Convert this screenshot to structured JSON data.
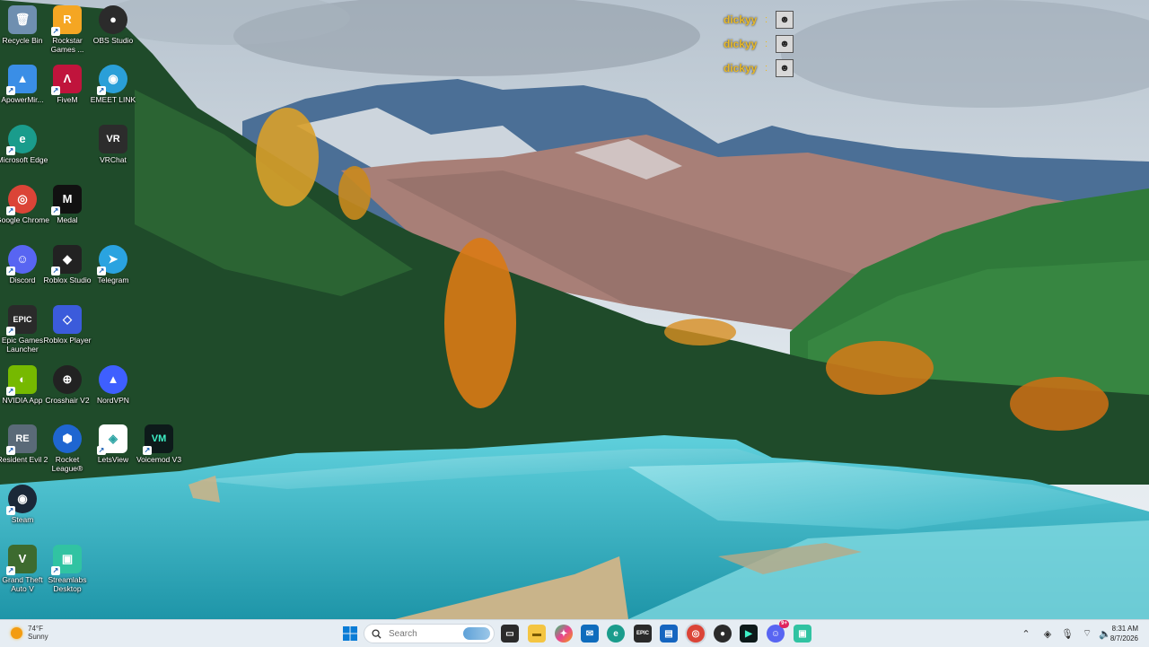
{
  "desktop": {
    "icons": [
      {
        "label": "Recycle Bin",
        "glyph": "🗑",
        "color": "#6f8fb0",
        "icon": "recycle-bin-icon"
      },
      {
        "label": "Rockstar Games ...",
        "glyph": "R",
        "color": "#f5a623",
        "icon": "rockstar-icon"
      },
      {
        "label": "OBS Studio",
        "glyph": "●",
        "color": "#2b2b2b",
        "icon": "obs-icon"
      },
      {
        "label": "ApowerMir...",
        "glyph": "▲",
        "color": "#3a8ee6",
        "icon": "apowermirror-icon"
      },
      {
        "label": "FiveM",
        "glyph": "Λ",
        "color": "#c0143c",
        "icon": "fivem-icon"
      },
      {
        "label": "EMEET LINK",
        "glyph": "◉",
        "color": "#2a9fd8",
        "icon": "emeet-icon"
      },
      {
        "label": "Microsoft Edge",
        "glyph": "e",
        "color": "#1a9c8c",
        "icon": "edge-icon"
      },
      {
        "label": "VRChat",
        "glyph": "VR",
        "color": "#2c2c2c",
        "icon": "vrchat-icon"
      },
      {
        "label": "Google Chrome",
        "glyph": "◎",
        "color": "#db4437",
        "icon": "chrome-icon"
      },
      {
        "label": "Medal",
        "glyph": "M",
        "color": "#111111",
        "icon": "medal-icon"
      },
      {
        "label": "Discord",
        "glyph": "☺",
        "color": "#5865f2",
        "icon": "discord-icon"
      },
      {
        "label": "Roblox Studio",
        "glyph": "◆",
        "color": "#222222",
        "icon": "roblox-studio-icon"
      },
      {
        "label": "Telegram",
        "glyph": "➤",
        "color": "#2aa3e0",
        "icon": "telegram-icon"
      },
      {
        "label": "Epic Games Launcher",
        "glyph": "EPIC",
        "color": "#2a2a2a",
        "icon": "epic-games-icon"
      },
      {
        "label": "Roblox Player",
        "glyph": "◇",
        "color": "#3b5bdb",
        "icon": "roblox-player-icon"
      },
      {
        "label": "NVIDIA App",
        "glyph": "◐",
        "color": "#76b900",
        "icon": "nvidia-icon"
      },
      {
        "label": "Crosshair V2",
        "glyph": "⊕",
        "color": "#222222",
        "icon": "crosshair-icon"
      },
      {
        "label": "NordVPN",
        "glyph": "▲",
        "color": "#3e5fff",
        "icon": "nordvpn-icon"
      },
      {
        "label": "Resident Evil 2",
        "glyph": "RE",
        "color": "#5a6a78",
        "icon": "resident-evil-icon"
      },
      {
        "label": "Rocket League®",
        "glyph": "⬢",
        "color": "#1f66d1",
        "icon": "rocket-league-icon"
      },
      {
        "label": "LetsView",
        "glyph": "◈",
        "color": "#ffffff",
        "icon": "letsview-icon"
      },
      {
        "label": "Voicemod V3",
        "glyph": "VM",
        "color": "#0d1a1a",
        "icon": "voicemod-icon"
      },
      {
        "label": "Steam",
        "glyph": "◉",
        "color": "#1b2838",
        "icon": "steam-icon"
      },
      {
        "label": "Grand Theft Auto V",
        "glyph": "V",
        "color": "#3d6b2f",
        "icon": "gta-icon"
      },
      {
        "label": "Streamlabs Desktop",
        "glyph": "▣",
        "color": "#31c3a2",
        "icon": "streamlabs-icon"
      }
    ]
  },
  "chat": {
    "messages": [
      {
        "user": "dickyy",
        "sep": ":"
      },
      {
        "user": "dickyy",
        "sep": ":"
      },
      {
        "user": "dickyy",
        "sep": ":"
      }
    ]
  },
  "taskbar": {
    "weather": {
      "temp": "74°F",
      "condition": "Sunny"
    },
    "search": {
      "placeholder": "Search"
    },
    "clock": {
      "time": "8:31 AM",
      "date": "8/7/2026"
    },
    "badge": "9+",
    "apps": [
      {
        "name": "start-button",
        "icon": "windows-logo-icon"
      },
      {
        "name": "task-view-button",
        "icon": "task-view-icon"
      },
      {
        "name": "file-explorer-button",
        "icon": "folder-icon"
      },
      {
        "name": "copilot-button",
        "icon": "copilot-icon"
      },
      {
        "name": "outlook-button",
        "icon": "outlook-icon"
      },
      {
        "name": "edge-button",
        "icon": "edge-icon"
      },
      {
        "name": "epic-games-button",
        "icon": "epic-games-icon"
      },
      {
        "name": "store-button",
        "icon": "store-icon"
      },
      {
        "name": "chrome-button",
        "icon": "chrome-icon"
      },
      {
        "name": "obs-button",
        "icon": "obs-icon"
      },
      {
        "name": "terminal-button",
        "icon": "terminal-icon"
      },
      {
        "name": "discord-button",
        "icon": "discord-icon"
      },
      {
        "name": "streamlabs-button",
        "icon": "streamlabs-icon"
      }
    ]
  }
}
